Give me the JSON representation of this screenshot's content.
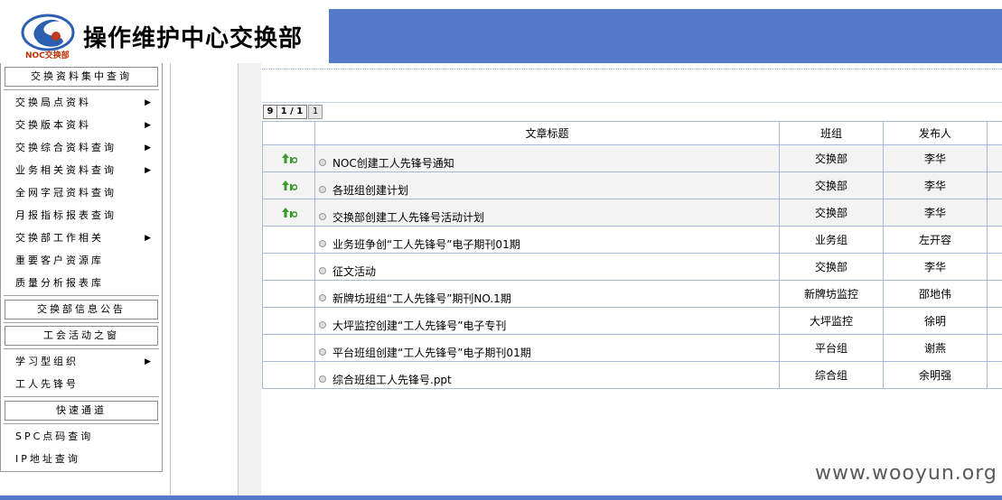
{
  "header": {
    "logo_text": "NOC交换部",
    "title": "操作维护中心交换部"
  },
  "sidebar": {
    "sections": [
      {
        "label": "交换资料集中查询"
      },
      {
        "label": "交换部信息公告"
      },
      {
        "label": "工会活动之窗"
      },
      {
        "label": "快速通道"
      }
    ],
    "items_1": [
      {
        "label": "交换局点资料",
        "arrow": "▶"
      },
      {
        "label": "交换版本资料",
        "arrow": "▶"
      },
      {
        "label": "交换综合资料查询",
        "arrow": "▶"
      },
      {
        "label": "业务相关资料查询",
        "arrow": "▶"
      },
      {
        "label": "全网字冠资料查询",
        "arrow": ""
      },
      {
        "label": "月报指标报表查询",
        "arrow": ""
      },
      {
        "label": "交换部工作相关",
        "arrow": "▶"
      },
      {
        "label": "重要客户资源库",
        "arrow": ""
      },
      {
        "label": "质量分析报表库",
        "arrow": ""
      }
    ],
    "items_3": [
      {
        "label": "学习型组织",
        "arrow": "▶"
      },
      {
        "label": "工人先锋号",
        "arrow": ""
      }
    ],
    "items_4": [
      {
        "label": "SPC点码查询",
        "arrow": ""
      },
      {
        "label": "IP地址查询",
        "arrow": ""
      }
    ]
  },
  "pager": {
    "total": "9",
    "current": "1 / 1",
    "page": "1"
  },
  "table": {
    "headers": [
      "",
      "文章标题",
      "班组",
      "发布人",
      ""
    ],
    "rows": [
      {
        "top": true,
        "title": "NOC创建工人先锋号通知",
        "group": "交换部",
        "author": "李华"
      },
      {
        "top": true,
        "title": "各班组创建计划",
        "group": "交换部",
        "author": "李华"
      },
      {
        "top": true,
        "title": "交换部创建工人先锋号活动计划",
        "group": "交换部",
        "author": "李华"
      },
      {
        "top": false,
        "title": "业务班争创“工人先锋号”电子期刊01期",
        "group": "业务组",
        "author": "左开容"
      },
      {
        "top": false,
        "title": "征文活动",
        "group": "交换部",
        "author": "李华"
      },
      {
        "top": false,
        "title": "新牌坊班组“工人先锋号”期刊NO.1期",
        "group": "新牌坊监控",
        "author": "邵地伟"
      },
      {
        "top": false,
        "title": "大坪监控创建“工人先锋号”电子专刊",
        "group": "大坪监控",
        "author": "徐明"
      },
      {
        "top": false,
        "title": "平台班组创建“工人先锋号”电子期刊01期",
        "group": "平台组",
        "author": "谢燕"
      },
      {
        "top": false,
        "title": "综合班组工人先锋号.ppt",
        "group": "综合组",
        "author": "余明强"
      }
    ]
  },
  "watermark": "www.wooyun.org",
  "colors": {
    "header_bar": "#5578c8",
    "table_border": "#a9b8d6",
    "top_icon": "#3a9a2a"
  }
}
